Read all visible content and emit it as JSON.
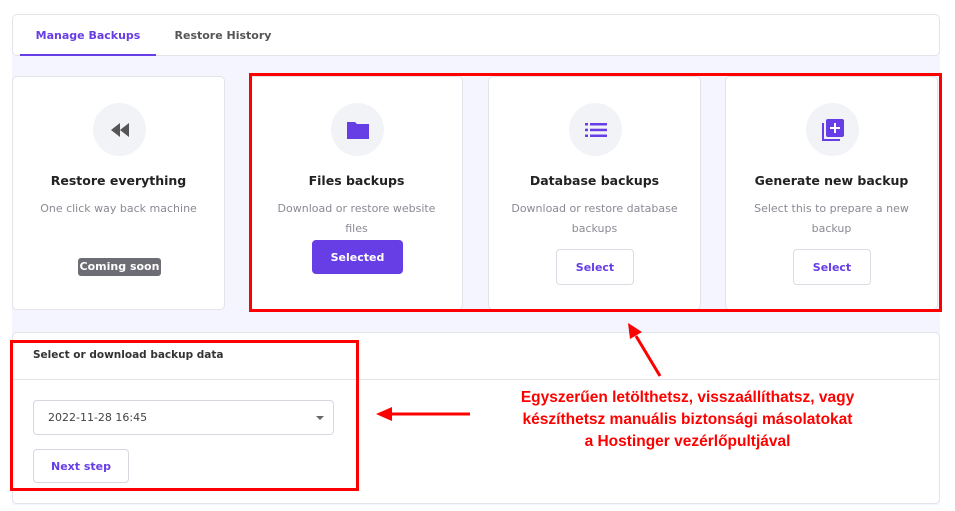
{
  "tabs": [
    {
      "label": "Manage Backups",
      "active": true
    },
    {
      "label": "Restore History",
      "active": false
    }
  ],
  "cards": [
    {
      "title": "Restore everything",
      "desc": "One click way back machine",
      "badge": "Coming soon",
      "icon": "rewind-icon"
    },
    {
      "title": "Files backups",
      "desc": "Download or restore website files",
      "button": "Selected",
      "icon": "folder-icon"
    },
    {
      "title": "Database backups",
      "desc": "Download or restore database backups",
      "button": "Select",
      "icon": "list-icon"
    },
    {
      "title": "Generate new backup",
      "desc": "Select this to prepare a new backup",
      "button": "Select",
      "icon": "add-library-icon"
    }
  ],
  "panel": {
    "title": "Select or download backup data",
    "selected_backup": "2022-11-28 16:45",
    "next_button": "Next step"
  },
  "annotation": {
    "lines": [
      "Egyszerűen letölthetsz, visszaállíthatsz, vagy",
      "készíthetsz manuális biztonsági másolatokat",
      "a Hostinger vezérlőpultjával"
    ]
  },
  "colors": {
    "accent": "#673de6",
    "annotation": "#ff0000"
  }
}
